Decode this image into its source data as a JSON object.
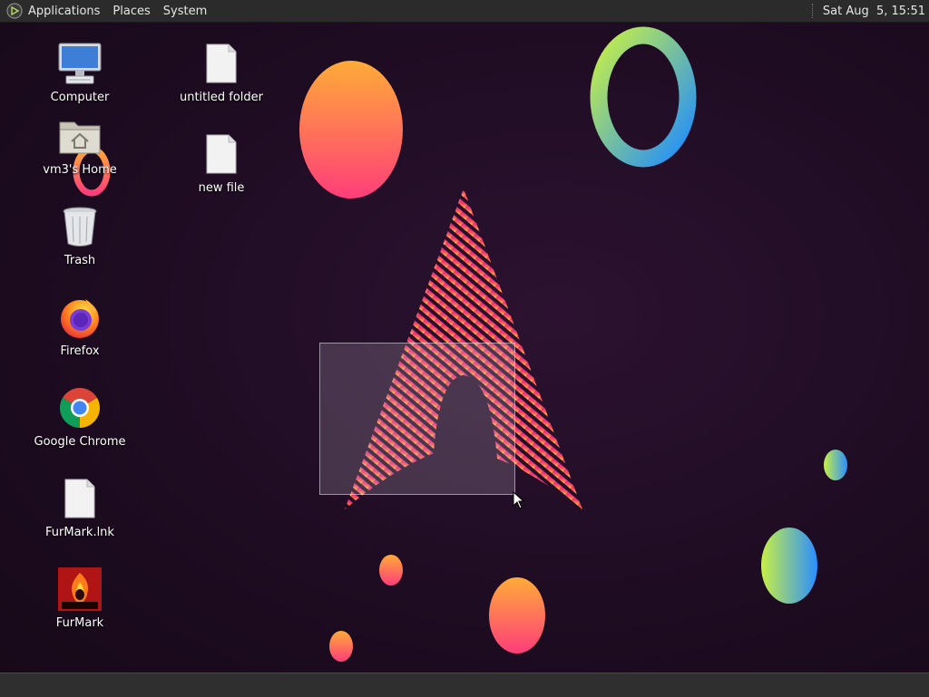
{
  "top_panel": {
    "menus": [
      "Applications",
      "Places",
      "System"
    ],
    "logo_icon": "distro-logo-icon",
    "clock": "Sat Aug  5, 15:51"
  },
  "desktop": {
    "icons": [
      {
        "label": "Computer",
        "icon": "computer-icon"
      },
      {
        "label": "vm3's Home",
        "icon": "home-folder-icon"
      },
      {
        "label": "Trash",
        "icon": "trash-icon"
      },
      {
        "label": "Firefox",
        "icon": "firefox-icon"
      },
      {
        "label": "Google Chrome",
        "icon": "chrome-icon"
      },
      {
        "label": "FurMark.lnk",
        "icon": "file-icon"
      },
      {
        "label": "FurMark",
        "icon": "furmark-icon"
      },
      {
        "label": "untitled folder",
        "icon": "file-icon"
      },
      {
        "label": "new file",
        "icon": "file-icon"
      }
    ]
  },
  "colors": {
    "accent_pink": "#e8357f",
    "accent_orange": "#ffa83a",
    "accent_blue": "#1e90ff",
    "accent_green": "#b8f05a",
    "panel": "#2b2b2b"
  }
}
